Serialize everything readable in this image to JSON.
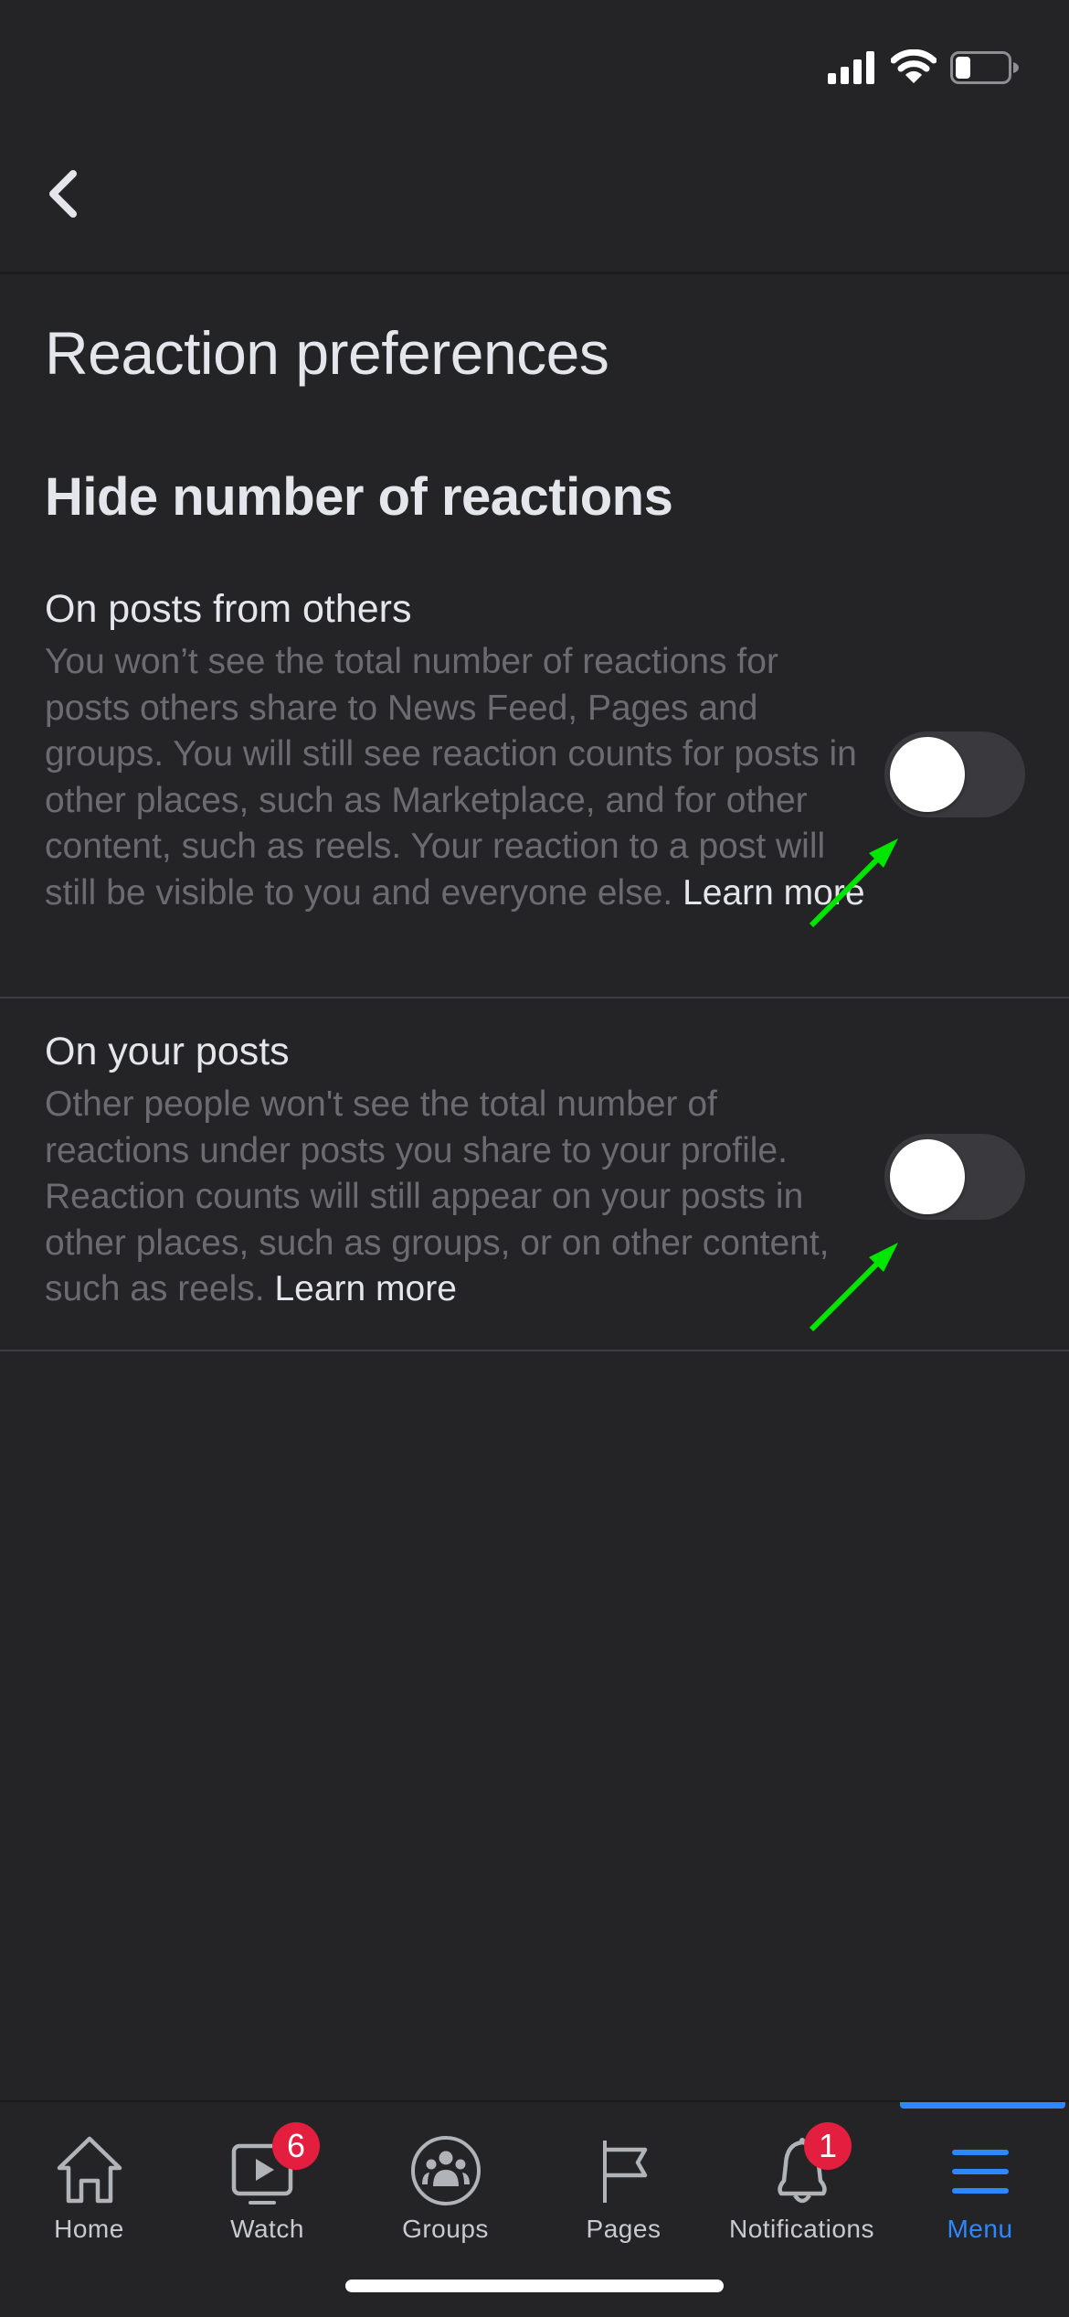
{
  "status_bar": {
    "signal_icon": "cellular-signal-icon",
    "wifi_icon": "wifi-icon",
    "battery_icon": "battery-icon",
    "battery_level": 0.2
  },
  "nav": {
    "back_icon": "chevron-left-icon"
  },
  "page": {
    "title": "Reaction preferences",
    "section_title": "Hide number of reactions",
    "settings": [
      {
        "title": "On posts from others",
        "description": "You won’t see the total number of reactions for posts others share to News Feed, Pages and groups. You will still see reaction counts for posts in other places, such as Marketplace, and for other content, such as reels. Your reaction to a post will still be visible to you and everyone else.",
        "learn_more": "Learn more",
        "enabled": false
      },
      {
        "title": "On your posts",
        "description": "Other people won't see the total number of reactions under posts you share to your profile. Reaction counts will still appear on your posts in other places, such as groups, or on other content, such as reels.",
        "learn_more": "Learn more",
        "enabled": false
      }
    ]
  },
  "annotations": {
    "arrow_color": "#00e600"
  },
  "tab_bar": {
    "active_color": "#2d88ff",
    "badge_color": "#e41e3f",
    "tabs": [
      {
        "label": "Home",
        "icon": "home-icon",
        "badge": null,
        "active": false
      },
      {
        "label": "Watch",
        "icon": "watch-video-icon",
        "badge": "6",
        "active": false
      },
      {
        "label": "Groups",
        "icon": "groups-icon",
        "badge": null,
        "active": false
      },
      {
        "label": "Pages",
        "icon": "flag-icon",
        "badge": null,
        "active": false
      },
      {
        "label": "Notifications",
        "icon": "bell-icon",
        "badge": "1",
        "active": false
      },
      {
        "label": "Menu",
        "icon": "hamburger-menu-icon",
        "badge": null,
        "active": true
      }
    ]
  }
}
